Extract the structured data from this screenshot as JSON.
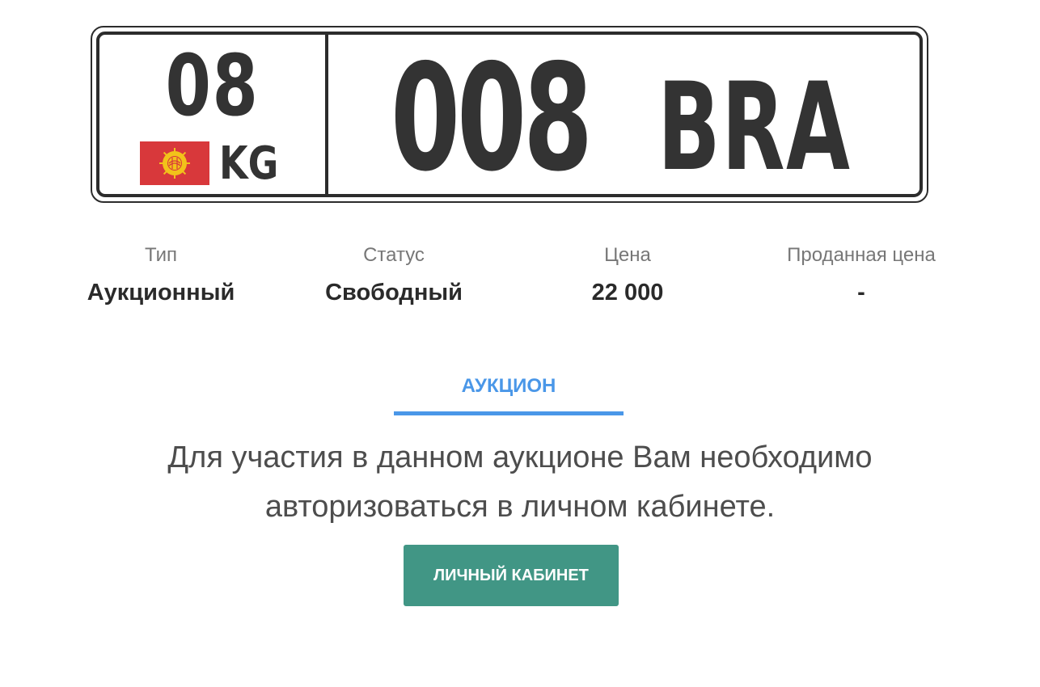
{
  "plate": {
    "region": "08",
    "country": "KG",
    "number": "008",
    "letters": "BRA"
  },
  "info": {
    "type_label": "Тип",
    "type_value": "Аукционный",
    "status_label": "Статус",
    "status_value": "Свободный",
    "price_label": "Цена",
    "price_value": "22 000",
    "sold_label": "Проданная цена",
    "sold_value": "-"
  },
  "tab": {
    "label": "АУКЦИОН"
  },
  "message": {
    "line1": "Для участия в данном аукционе Вам необходимо",
    "line2": "авторизоваться в личном кабинете."
  },
  "button": {
    "label": "ЛИЧНЫЙ КАБИНЕТ"
  },
  "colors": {
    "accent": "#4a97e8",
    "button": "#419685",
    "flag_red": "#d8383b",
    "flag_sun": "#f2c21a"
  },
  "icons": {
    "flag": "kyrgyzstan-flag-icon"
  }
}
